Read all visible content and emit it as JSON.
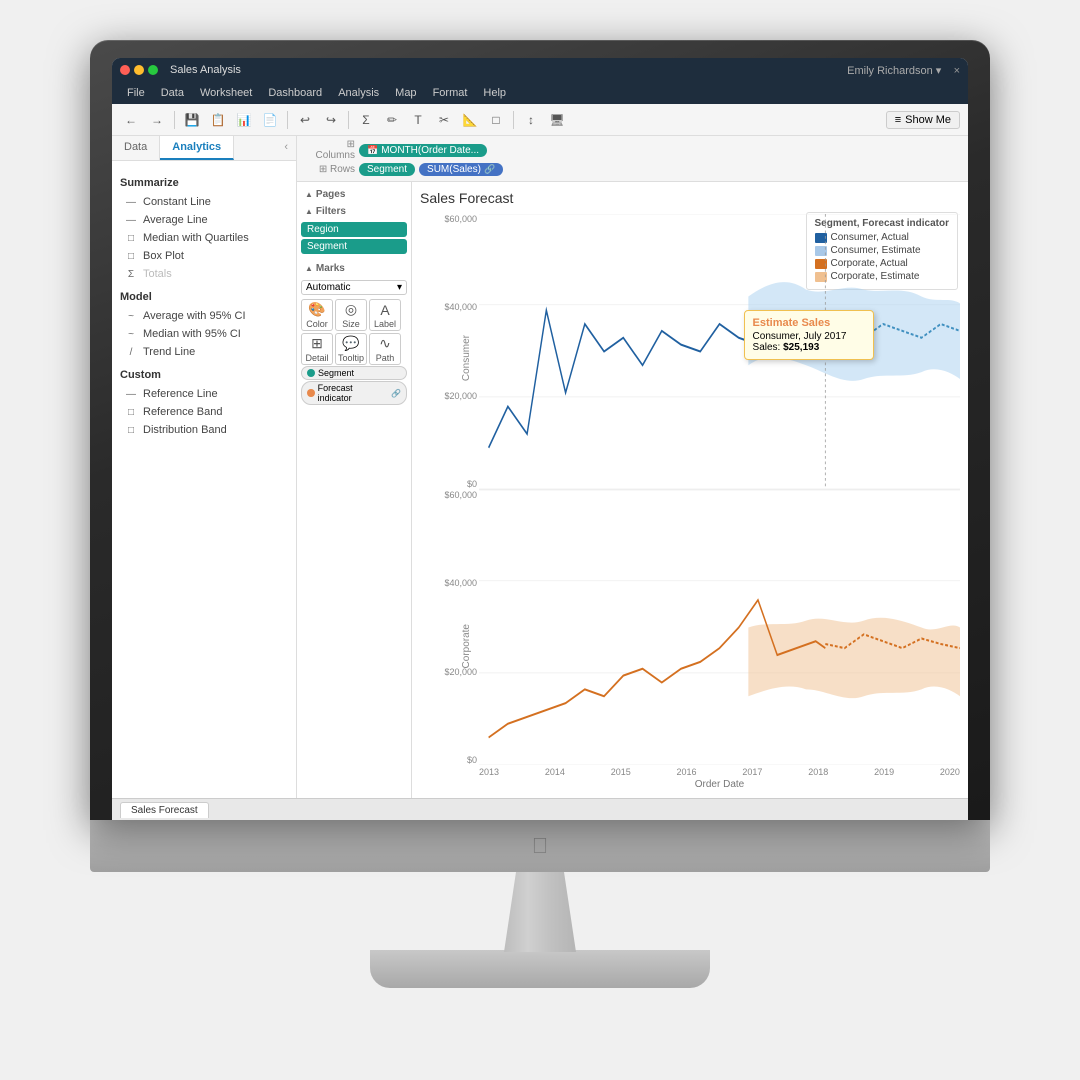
{
  "window": {
    "title": "Sales Analysis",
    "close_label": "×",
    "user": "Emily Richardson ▾",
    "show_me_label": "Show Me"
  },
  "menu": {
    "items": [
      "File",
      "Data",
      "Worksheet",
      "Dashboard",
      "Analysis",
      "Map",
      "Format",
      "Help"
    ]
  },
  "toolbar": {
    "buttons": [
      "←",
      "→",
      "💾",
      "📋",
      "📊",
      "📄",
      "↩",
      "↪",
      "Σ",
      "✏",
      "T",
      "✂",
      "📐",
      "□",
      "T",
      "↕",
      "🖥"
    ]
  },
  "panel_tabs": {
    "data_label": "Data",
    "analytics_label": "Analytics"
  },
  "analytics": {
    "summarize_title": "Summarize",
    "items_summarize": [
      {
        "label": "Constant Line",
        "icon": "—"
      },
      {
        "label": "Average Line",
        "icon": "—"
      },
      {
        "label": "Median with Quartiles",
        "icon": "□"
      },
      {
        "label": "Box Plot",
        "icon": "□"
      },
      {
        "label": "Totals",
        "icon": "Σ"
      }
    ],
    "model_title": "Model",
    "items_model": [
      {
        "label": "Average with 95% CI",
        "icon": "~"
      },
      {
        "label": "Median with 95% CI",
        "icon": "~"
      },
      {
        "label": "Trend Line",
        "icon": "/"
      }
    ],
    "custom_title": "Custom",
    "items_custom": [
      {
        "label": "Reference Line",
        "icon": "—"
      },
      {
        "label": "Reference Band",
        "icon": "□"
      },
      {
        "label": "Distribution Band",
        "icon": "□"
      }
    ]
  },
  "filters": {
    "title": "Filters",
    "pills": [
      "Region",
      "Segment"
    ]
  },
  "marks": {
    "title": "Marks",
    "type": "Automatic",
    "buttons": [
      {
        "label": "Color",
        "icon": "🎨"
      },
      {
        "label": "Size",
        "icon": "◉"
      },
      {
        "label": "Label",
        "icon": "A"
      },
      {
        "label": "Detail",
        "icon": "⊞"
      },
      {
        "label": "Tooltip",
        "icon": "💬"
      },
      {
        "label": "Path",
        "icon": "∿"
      }
    ],
    "fields": [
      {
        "label": "Segment",
        "type": "teal"
      },
      {
        "label": "Forecast indicator",
        "type": "orange"
      }
    ]
  },
  "shelves": {
    "columns_label": "Columns",
    "rows_label": "Rows",
    "columns_pill": "MONTH(Order Date...",
    "rows_pills": [
      "Segment",
      "SUM(Sales)"
    ]
  },
  "chart": {
    "title": "Sales Forecast",
    "y_labels_top": [
      "$60,000",
      "$40,000",
      "$20,000",
      "$0"
    ],
    "y_labels_bottom": [
      "$60,000",
      "$40,000",
      "$20,000",
      "$0"
    ],
    "x_labels": [
      "2013",
      "2014",
      "2015",
      "2016",
      "2017",
      "2018",
      "2019",
      "2020"
    ],
    "x_axis_label": "Order Date",
    "segment_top": "Consumer",
    "segment_bottom": "Corporate",
    "legend_title": "Segment, Forecast indicator",
    "legend_items": [
      {
        "label": "Consumer, Actual",
        "color": "#2060a0"
      },
      {
        "label": "Consumer, Estimate",
        "color": "#a8c8e8"
      },
      {
        "label": "Corporate, Actual",
        "color": "#d47020"
      },
      {
        "label": "Corporate, Estimate",
        "color": "#f0c090"
      }
    ]
  },
  "tooltip": {
    "title": "Estimate Sales",
    "segment": "Consumer, July 2017",
    "sales_label": "Sales:",
    "sales_value": "$25,193"
  },
  "bottom_tab": {
    "label": "Sales Forecast"
  }
}
